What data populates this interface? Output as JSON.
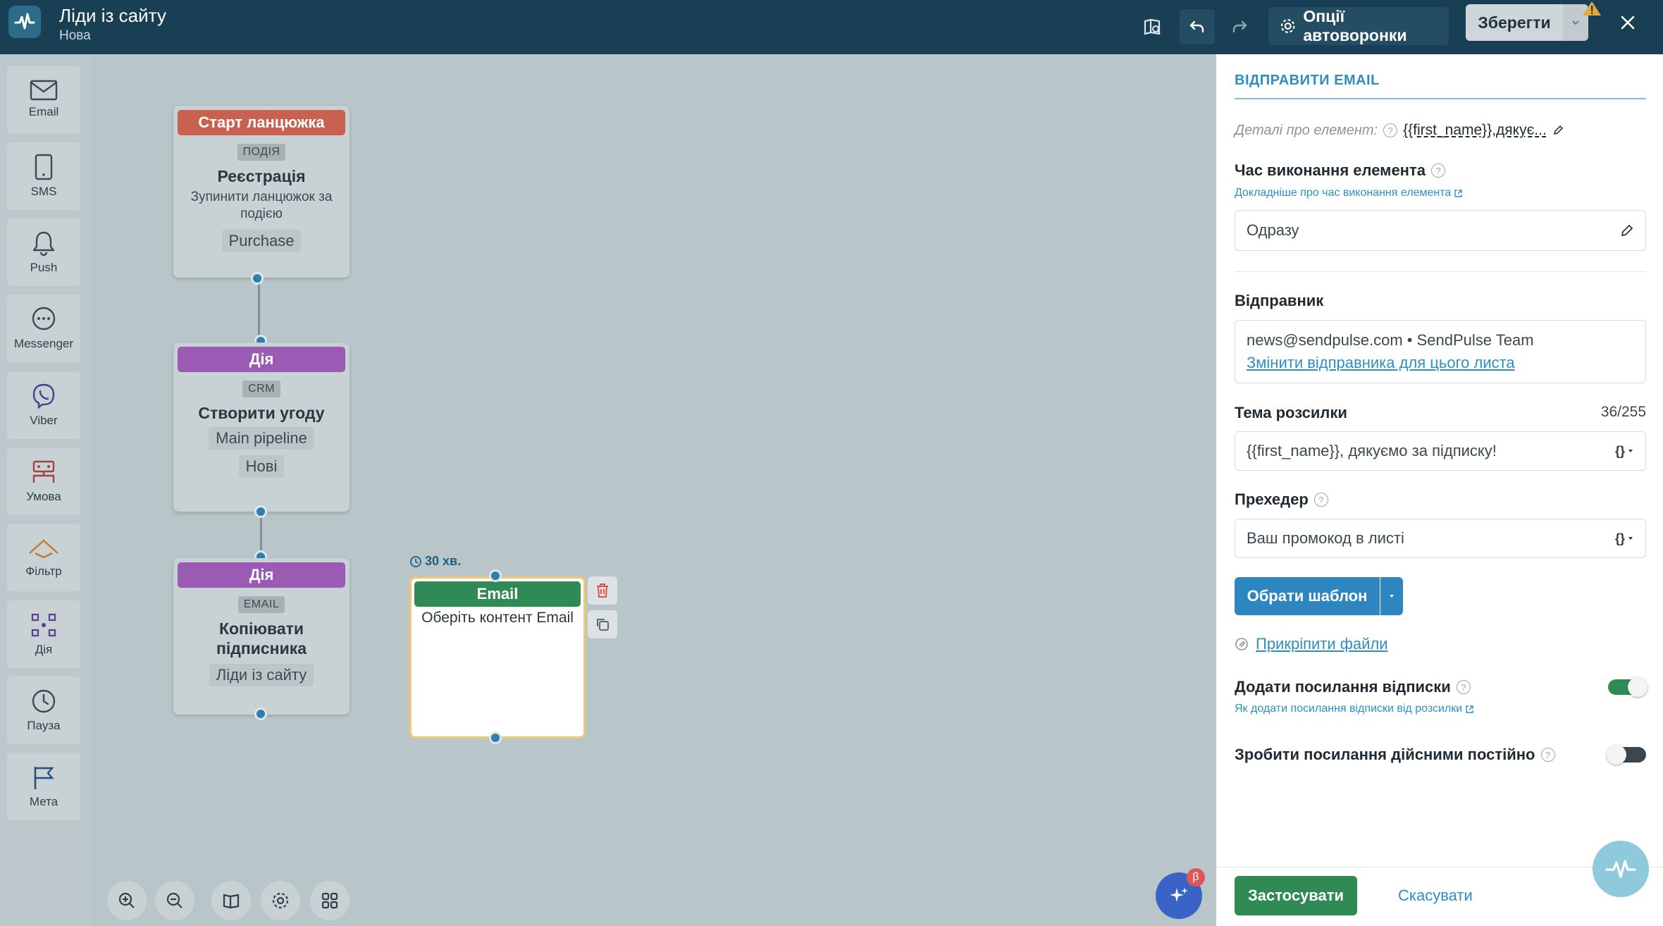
{
  "header": {
    "title": "Ліди із сайту",
    "subtitle": "Нова",
    "options_label": "Опції автоворонки",
    "save_label": "Зберегти"
  },
  "tools": [
    {
      "label": "Email",
      "icon": "envelope-icon"
    },
    {
      "label": "SMS",
      "icon": "phone-icon"
    },
    {
      "label": "Push",
      "icon": "bell-icon"
    },
    {
      "label": "Messenger",
      "icon": "chat-bubble-icon"
    },
    {
      "label": "Viber",
      "icon": "viber-icon"
    },
    {
      "label": "Умова",
      "icon": "condition-icon"
    },
    {
      "label": "Фільтр",
      "icon": "filter-icon"
    },
    {
      "label": "Дія",
      "icon": "action-icon"
    },
    {
      "label": "Пауза",
      "icon": "clock-icon"
    },
    {
      "label": "Мета",
      "icon": "flag-icon"
    }
  ],
  "flow": {
    "start": {
      "header": "Старт ланцюжка",
      "chip": "ПОДІЯ",
      "title": "Реєстрація",
      "text": "Зупинити ланцюжок за подією",
      "tag": "Purchase"
    },
    "action1": {
      "header": "Дія",
      "chip": "CRM",
      "title": "Створити угоду",
      "tag1": "Main pipeline",
      "tag2": "Нові"
    },
    "action2": {
      "header": "Дія",
      "chip": "EMAIL",
      "title": "Копіювати підписника",
      "tag": "Ліди із сайту"
    },
    "email": {
      "delay": "30 хв.",
      "header": "Email",
      "text": "Оберіть контент Email"
    }
  },
  "ai_badge": "β",
  "panel": {
    "heading": "ВІДПРАВИТИ EMAIL",
    "details_label": "Деталі про елемент:",
    "details_value": "{{first_name}},дякує...",
    "exec_time_label": "Час виконання елемента",
    "exec_time_link": "Докладніше про час виконання елемента",
    "exec_time_value": "Одразу",
    "sender_label": "Відправник",
    "sender_value": "news@sendpulse.com • SendPulse Team",
    "sender_change": "Змінити відправника для цього листа",
    "subject_label": "Тема розсилки",
    "subject_count": "36/255",
    "subject_value": "{{first_name}}, дякуємо за підписку!",
    "preheader_label": "Прехедер",
    "preheader_value": "Ваш промокод в листі",
    "template_btn": "Обрати шаблон",
    "attach_label": "Прикріпити файли",
    "unsub_label": "Додати посилання відписки",
    "unsub_link": "Як додати посилання відписки від розсилки",
    "unsub_on": true,
    "permanent_label": "Зробити посилання дійсними постійно",
    "permanent_on": false,
    "apply_btn": "Застосувати",
    "cancel_btn": "Скасувати"
  },
  "colors": {
    "topbar": "#193f55",
    "start_header": "#c8614f",
    "action_header": "#9b5bb5",
    "email_header": "#2f8a55",
    "accent": "#2d8fbf"
  }
}
